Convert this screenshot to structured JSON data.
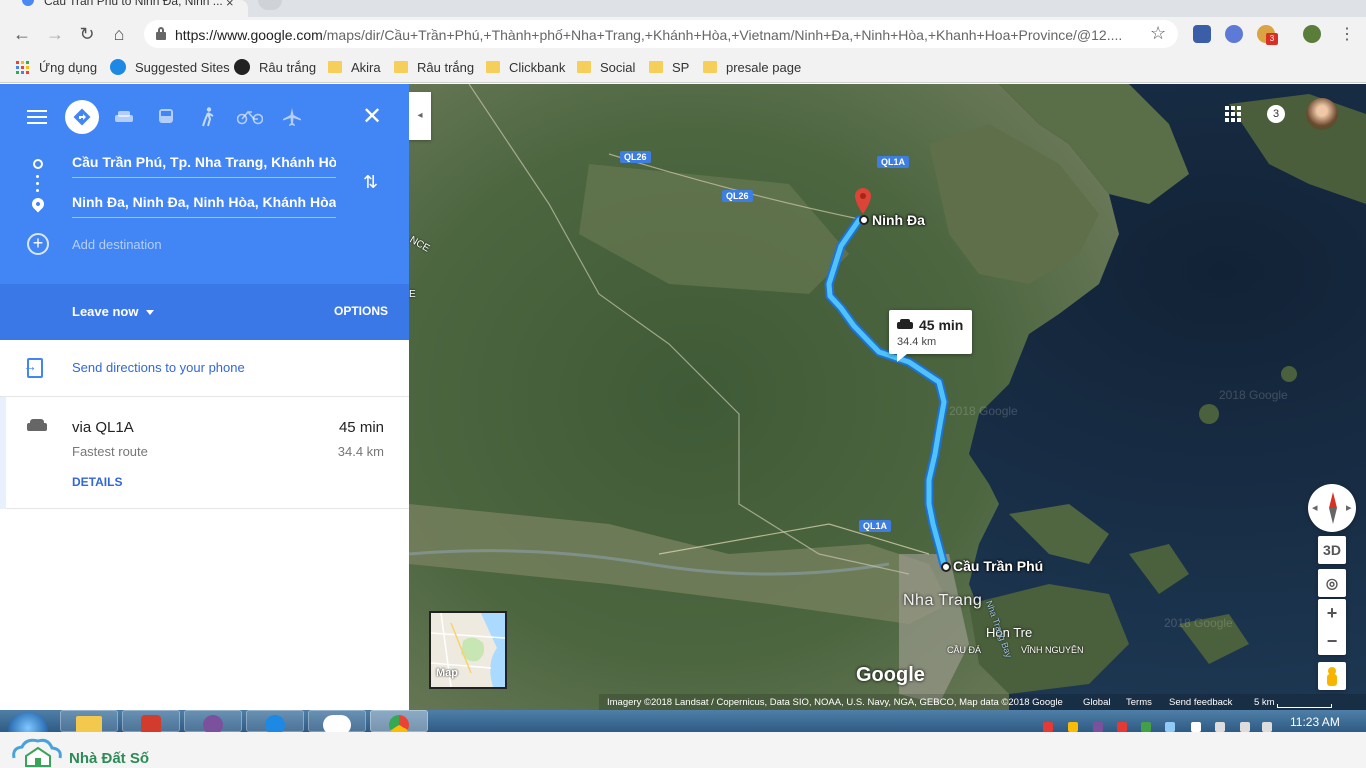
{
  "browser": {
    "tab_title": "Cầu Trần Phú to Ninh Đa, Ninh ...",
    "tab_close": "×",
    "url_host": "https://www.google.com",
    "url_rest": "/maps/dir/Cầu+Trần+Phú,+Thành+phố+Nha+Trang,+Khánh+Hòa,+Vietnam/Ninh+Đa,+Ninh+Hòa,+Khanh+Hoa+Province/@12....",
    "ext_badge": "3",
    "back_icon": "arrow-left-icon",
    "forward_icon": "arrow-right-icon",
    "reload_icon": "reload-icon",
    "home_icon": "home-icon"
  },
  "bookmarks": [
    {
      "label": "Ứng dụng",
      "icon": "apps-icon"
    },
    {
      "label": "Suggested Sites",
      "icon": "ie-icon"
    },
    {
      "label": "Râu trắng",
      "icon": "github-icon"
    },
    {
      "label": "Akira",
      "icon": "folder-icon"
    },
    {
      "label": "Râu trắng",
      "icon": "folder-icon"
    },
    {
      "label": "Clickbank",
      "icon": "folder-icon"
    },
    {
      "label": "Social",
      "icon": "folder-icon"
    },
    {
      "label": "SP",
      "icon": "folder-icon"
    },
    {
      "label": "presale page",
      "icon": "folder-icon"
    }
  ],
  "directions": {
    "origin": "Cầu Trần Phú, Tp. Nha Trang, Khánh Hòa",
    "destination": "Ninh Đa, Ninh Đa, Ninh Hòa, Khánh Hòa",
    "add_destination": "Add destination",
    "leave_now": "Leave now",
    "options": "OPTIONS",
    "send": "Send directions to your phone",
    "route": {
      "via": "via QL1A",
      "note": "Fastest route",
      "duration": "45 min",
      "distance": "34.4 km",
      "details": "DETAILS"
    }
  },
  "map": {
    "roads": [
      "QL26",
      "QL1A",
      "QL26",
      "QL1A"
    ],
    "dest_label": "Ninh Đa",
    "origin_label": "Cầu Trần Phú",
    "city": "Nha Trang",
    "hon_tre": "Hòn Tre",
    "cau_da": "CẦU ĐÁ",
    "vinh_nguyen": "VĨNH NGUYÊN",
    "nha_trang_bay": "Nha Trang Bay",
    "edge_text_1": "NCE",
    "edge_text_2": "E",
    "watermark": "2018 Google",
    "callout_time": "45 min",
    "callout_dist": "34.4 km",
    "minimap_label": "Map",
    "google": "Google",
    "attribution": "Imagery ©2018 Landsat / Copernicus, Data SIO, NOAA, U.S. Navy, NGA, GEBCO, Map data ©2018 Google",
    "global": "Global",
    "terms": "Terms",
    "feedback": "Send feedback",
    "scale": "5 km",
    "btn_3d": "3D",
    "notif_count": "3",
    "compass_left": "◂",
    "compass_right": "▸",
    "zoom_in": "+",
    "zoom_out": "−",
    "route_color": "#4fc3f7",
    "pin_color": "#db4437"
  },
  "taskbar": {
    "time": "11:23 AM"
  },
  "footer": {
    "brand": "Nhà Đất Số"
  }
}
